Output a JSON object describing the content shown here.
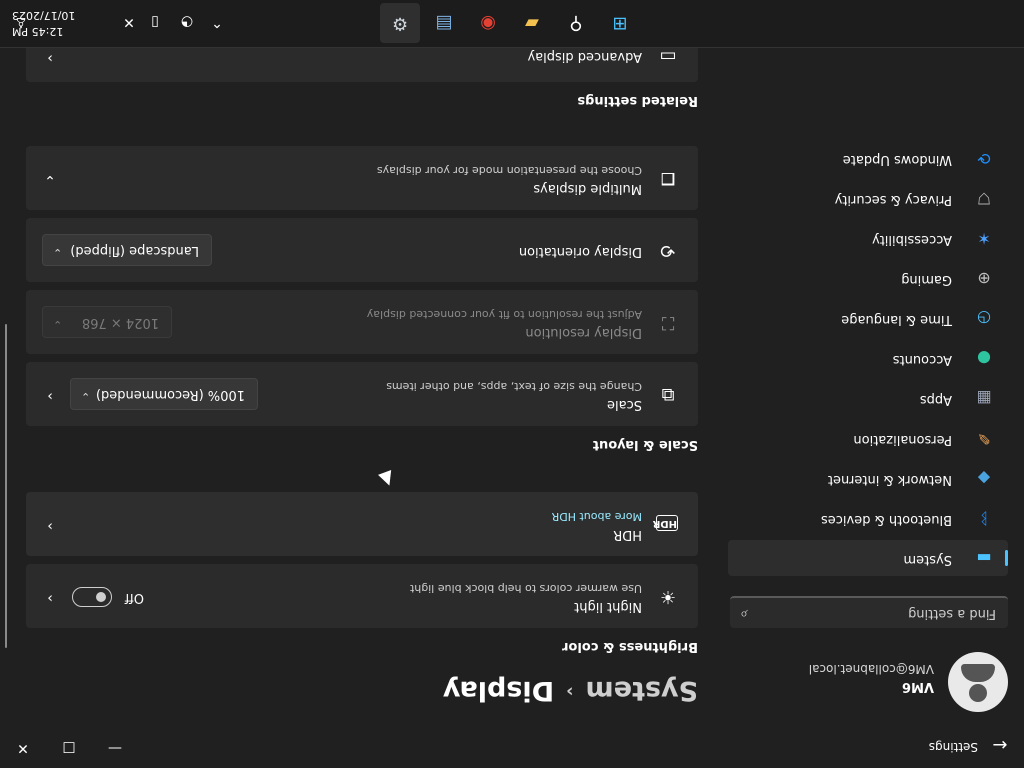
{
  "window": {
    "title": "Settings",
    "back_icon": "←",
    "minimize_icon": "—",
    "maximize_icon": "□",
    "close_icon": "✕"
  },
  "user": {
    "name": "VM6",
    "email": "VM6@collabnet.local"
  },
  "search": {
    "placeholder": "Find a setting",
    "icon": "search-icon"
  },
  "sidebar": {
    "items": [
      {
        "label": "System",
        "icon": "monitor-icon",
        "color": "#4cc2ff",
        "active": true
      },
      {
        "label": "Bluetooth & devices",
        "icon": "bluetooth-icon",
        "color": "#1e90ff"
      },
      {
        "label": "Network & internet",
        "icon": "network-icon",
        "color": "#4aa3df"
      },
      {
        "label": "Personalization",
        "icon": "brush-icon",
        "color": "#e8a25a"
      },
      {
        "label": "Apps",
        "icon": "apps-icon",
        "color": "#9aa3b5"
      },
      {
        "label": "Accounts",
        "icon": "accounts-icon",
        "color": "#2ec4a0"
      },
      {
        "label": "Time & language",
        "icon": "time-language-icon",
        "color": "#4cc2ff"
      },
      {
        "label": "Gaming",
        "icon": "gaming-icon",
        "color": "#bfbfbf"
      },
      {
        "label": "Accessibility",
        "icon": "accessibility-icon",
        "color": "#4ca0ff"
      },
      {
        "label": "Privacy & security",
        "icon": "shield-icon",
        "color": "#b0b0b0"
      },
      {
        "label": "Windows Update",
        "icon": "update-icon",
        "color": "#1e90ff"
      }
    ]
  },
  "breadcrumb": {
    "parent": "System",
    "separator": "›",
    "current": "Display"
  },
  "sections": {
    "brightness": "Brightness & color",
    "scale_layout": "Scale & layout",
    "related": "Related settings"
  },
  "cards": {
    "night_light": {
      "title": "Night light",
      "subtitle": "Use warmer colors to help block blue light",
      "toggle_label": "Off",
      "toggle_on": false
    },
    "hdr": {
      "title": "HDR",
      "link": "More about HDR"
    },
    "scale": {
      "title": "Scale",
      "subtitle": "Change the size of text, apps, and other items",
      "value": "100% (Recommended)"
    },
    "resolution": {
      "title": "Display resolution",
      "subtitle": "Adjust the resolution to fit your connected display",
      "value": "1024 × 768",
      "disabled": true
    },
    "orientation": {
      "title": "Display orientation",
      "value": "Landscape (flipped)"
    },
    "multiple": {
      "title": "Multiple displays",
      "subtitle": "Choose the presentation mode for your displays"
    },
    "advanced": {
      "title": "Advanced display"
    }
  },
  "taskbar": {
    "time": "12:45 PM",
    "date": "10/17/2023",
    "apps": [
      "start-icon",
      "search-icon",
      "file-explorer-icon",
      "chrome-icon",
      "task-manager-icon",
      "settings-icon"
    ]
  }
}
